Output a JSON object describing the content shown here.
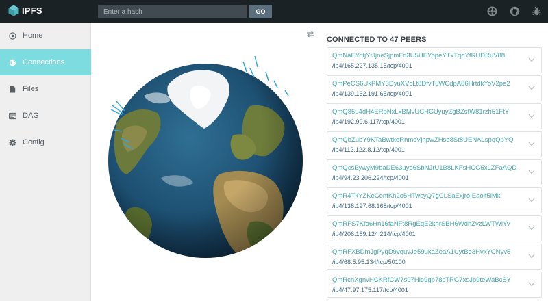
{
  "app": {
    "name": "IPFS"
  },
  "search": {
    "placeholder": "Enter a hash",
    "go_label": "GO"
  },
  "top_icons": [
    "settings-wheel-icon",
    "github-icon",
    "bug-icon"
  ],
  "sidebar": {
    "items": [
      {
        "label": "Home",
        "icon": "home-icon",
        "active": false
      },
      {
        "label": "Connections",
        "icon": "globe-icon",
        "active": true
      },
      {
        "label": "Files",
        "icon": "file-icon",
        "active": false
      },
      {
        "label": "DAG",
        "icon": "dag-icon",
        "active": false
      },
      {
        "label": "Config",
        "icon": "gear-icon",
        "active": false
      }
    ]
  },
  "connections": {
    "title": "CONNECTED TO 47 PEERS",
    "peers": [
      {
        "id": "QmNaEYqfjYtJjneSjpmFd3U5UEYopeYTxTqqYtRUDRuV88",
        "address": "/ip4/165.227.135.15/tcp/4001"
      },
      {
        "id": "QmPeCS6UkPMY3DyuXVcLt8DfvTuWCdpA86HrtdkYoV2pe2",
        "address": "/ip4/139.162.191.65/tcp/4001"
      },
      {
        "id": "QmQ85u4dH4ERpNxLxBMvUCHCUyuyZgBZsfW81rzh51FtY",
        "address": "/ip4/192.99.6.117/tcp/4001"
      },
      {
        "id": "QmQbZubY9KTaBwtkeRnmcVjhpwZHso8St8UENALspqQpYQ",
        "address": "/ip4/112.122.8.12/tcp/4001"
      },
      {
        "id": "QmQcsEywyM9baDE63uyo6SbNJrU1B8LKFsHCG5xLZFaAQD",
        "address": "/ip4/94.23.206.224/tcp/4001"
      },
      {
        "id": "QmR4TkYZKeConfKh2o5HTwsyQ7gCLSaExjroIEaoit5iMk",
        "address": "/ip4/138.197.68.168/tcp/4001"
      },
      {
        "id": "QmRFS7Kfo6Hn16faNFt8RgEqE2khrSBH6WdhZvzLWTWiYv",
        "address": "/ip4/206.189.124.214/tcp/4001"
      },
      {
        "id": "QmRFXBDmJgPyqD9vquvJe59ukaZeaA1UytBo3HvkYCNyv5",
        "address": "/ip4/68.5.95.134/tcp/50100"
      },
      {
        "id": "QmRchXgnvHCKRfCW7s97Hio9gb78sTRG7xsJp9teWaBcSY",
        "address": "/ip4/47.97.175.117/tcp/4001"
      }
    ]
  },
  "colors": {
    "topbar": "#1b2226",
    "sidebar_bg": "#efefef",
    "active_item": "#7ddcdf",
    "peer_id": "#45a8ad",
    "peer_address": "#3f6a86",
    "peer_line_marks": "#33a4e0"
  }
}
